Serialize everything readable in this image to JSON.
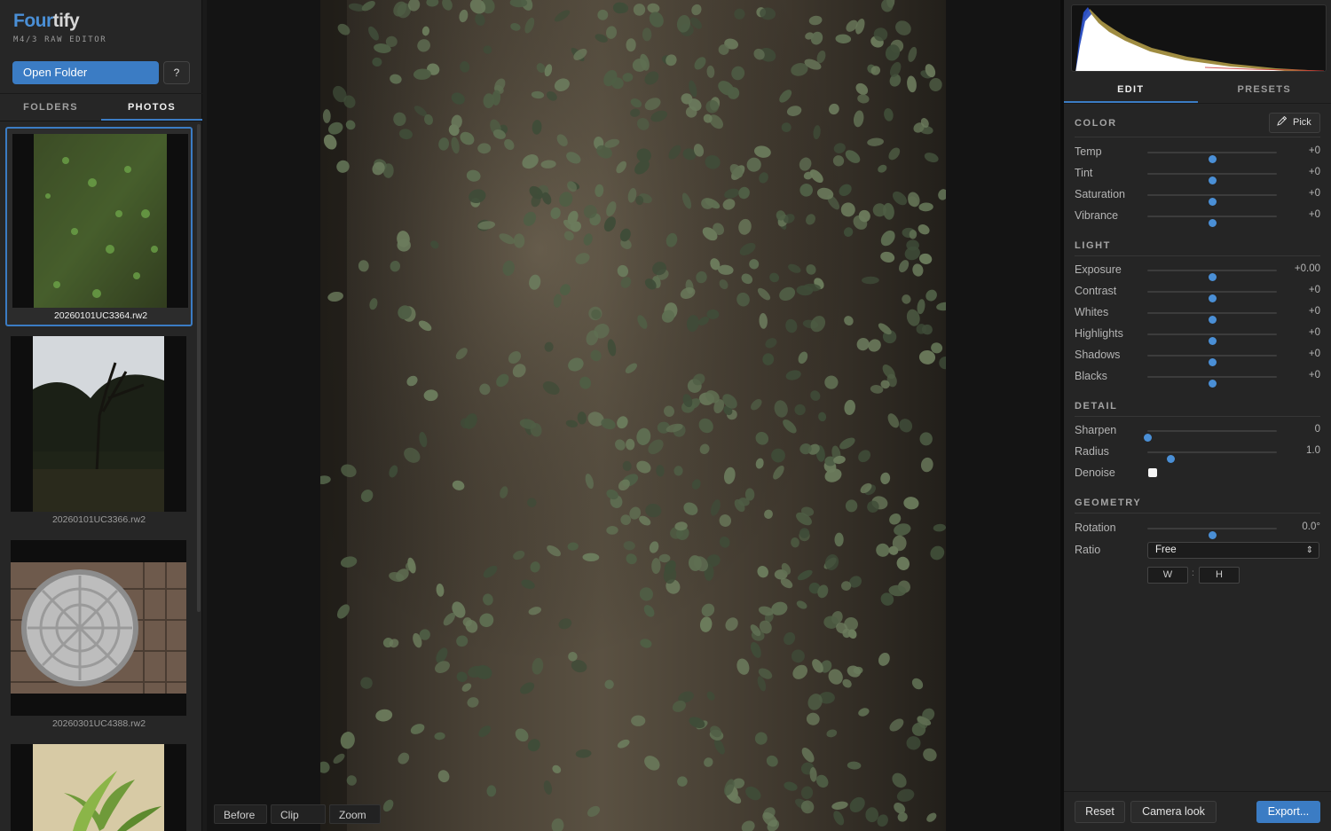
{
  "app": {
    "name_part1": "Four",
    "name_part2": "tify",
    "tagline": "M4/3 RAW EDITOR",
    "accent_color": "#3b7cc4"
  },
  "sidebar": {
    "open_folder_label": "Open Folder",
    "help_label": "?",
    "tabs": [
      {
        "label": "FOLDERS",
        "active": false
      },
      {
        "label": "PHOTOS",
        "active": true
      }
    ],
    "photos": [
      {
        "filename": "20260101UC3364.rw2",
        "selected": true
      },
      {
        "filename": "20260101UC3366.rw2",
        "selected": false
      },
      {
        "filename": "20260301UC4388.rw2",
        "selected": false
      },
      {
        "filename": "",
        "selected": false
      }
    ]
  },
  "viewer": {
    "buttons": [
      "Before",
      "Clip",
      "Zoom"
    ]
  },
  "panel": {
    "tabs": [
      {
        "label": "EDIT",
        "active": true
      },
      {
        "label": "PRESETS",
        "active": false
      }
    ],
    "pick_label": "Pick",
    "sections": {
      "color": {
        "title": "COLOR",
        "sliders": [
          {
            "label": "Temp",
            "value": "+0",
            "position": 0.5
          },
          {
            "label": "Tint",
            "value": "+0",
            "position": 0.5
          },
          {
            "label": "Saturation",
            "value": "+0",
            "position": 0.5
          },
          {
            "label": "Vibrance",
            "value": "+0",
            "position": 0.5
          }
        ]
      },
      "light": {
        "title": "LIGHT",
        "sliders": [
          {
            "label": "Exposure",
            "value": "+0.00",
            "position": 0.5
          },
          {
            "label": "Contrast",
            "value": "+0",
            "position": 0.5
          },
          {
            "label": "Whites",
            "value": "+0",
            "position": 0.5
          },
          {
            "label": "Highlights",
            "value": "+0",
            "position": 0.5
          },
          {
            "label": "Shadows",
            "value": "+0",
            "position": 0.5
          },
          {
            "label": "Blacks",
            "value": "+0",
            "position": 0.5
          }
        ]
      },
      "detail": {
        "title": "DETAIL",
        "sharpen": {
          "label": "Sharpen",
          "value": "0",
          "position": 0.0
        },
        "radius": {
          "label": "Radius",
          "value": "1.0",
          "position": 0.18
        },
        "denoise": {
          "label": "Denoise",
          "checked": false
        }
      },
      "geometry": {
        "title": "GEOMETRY",
        "rotation": {
          "label": "Rotation",
          "value": "0.0°",
          "position": 0.5
        },
        "ratio_label": "Ratio",
        "ratio_value": "Free",
        "width_placeholder": "W",
        "colon": ":",
        "height_placeholder": "H"
      }
    },
    "footer": {
      "reset_label": "Reset",
      "camera_look_label": "Camera look",
      "export_label": "Export..."
    }
  }
}
